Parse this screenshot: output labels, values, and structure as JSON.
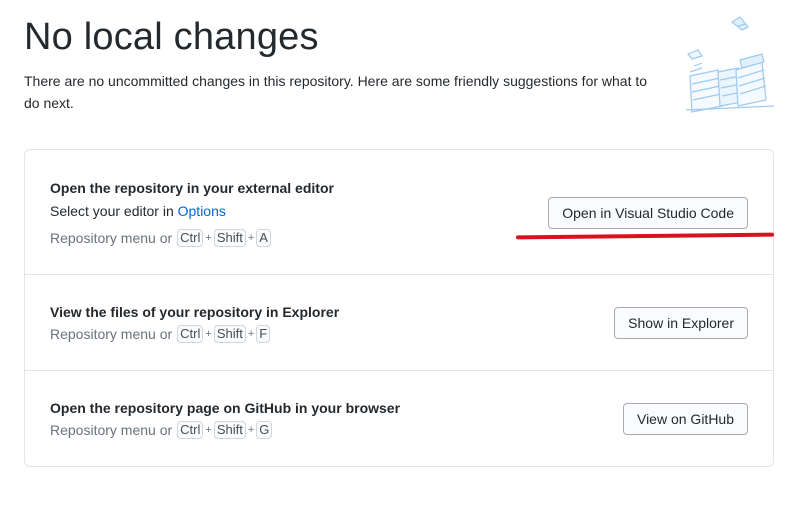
{
  "header": {
    "title": "No local changes",
    "subtitle": "There are no uncommitted changes in this repository. Here are some friendly suggestions for what to do next."
  },
  "suggestions": [
    {
      "title": "Open the repository in your external editor",
      "desc_prefix": "Select your editor in ",
      "desc_link": "Options",
      "shortcut_prefix": "Repository menu or",
      "keys": [
        "Ctrl",
        "Shift",
        "A"
      ],
      "button": "Open in Visual Studio Code"
    },
    {
      "title": "View the files of your repository in Explorer",
      "shortcut_prefix": "Repository menu or",
      "keys": [
        "Ctrl",
        "Shift",
        "F"
      ],
      "button": "Show in Explorer"
    },
    {
      "title": "Open the repository page on GitHub in your browser",
      "shortcut_prefix": "Repository menu or",
      "keys": [
        "Ctrl",
        "Shift",
        "G"
      ],
      "button": "View on GitHub"
    }
  ],
  "plus_sign": "+",
  "colors": {
    "link": "#0366d6",
    "annotation": "#d9121f",
    "border": "#e1e4e8"
  },
  "icons": {
    "illustration": "paper-stacks-illustration"
  }
}
